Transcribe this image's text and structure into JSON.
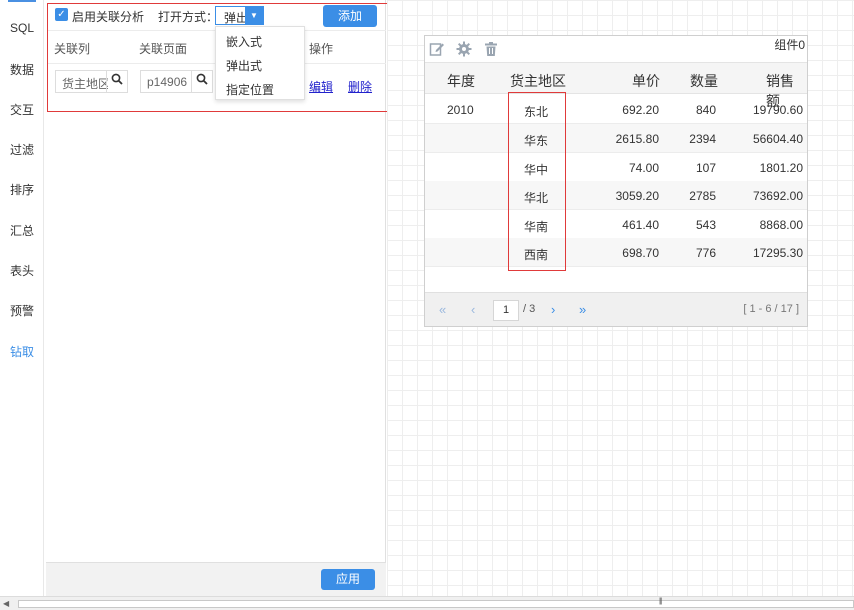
{
  "left_nav": {
    "items": [
      {
        "label": "SQL"
      },
      {
        "label": "数据"
      },
      {
        "label": "交互"
      },
      {
        "label": "过滤"
      },
      {
        "label": "排序"
      },
      {
        "label": "汇总"
      },
      {
        "label": "表头"
      },
      {
        "label": "预警"
      },
      {
        "label": "钻取"
      }
    ],
    "active_label": "钻取"
  },
  "link_panel": {
    "enable_label": "启用关联分析",
    "enabled": true,
    "open_mode_label": "打开方式：",
    "open_mode_value": "弹出",
    "open_mode_options": [
      "嵌入式",
      "弹出式",
      "指定位置"
    ],
    "add_button": "添加",
    "columns": {
      "link_col": "关联列",
      "link_page": "关联页面",
      "action": "操作"
    },
    "row": {
      "col_value": "货主地区",
      "page_value": "p14906",
      "edit": "编辑",
      "delete": "删除"
    },
    "apply_button": "应用"
  },
  "widget": {
    "title": "组件0",
    "icons": [
      "edit-icon",
      "gear-icon",
      "trash-icon"
    ],
    "headers": [
      "年度",
      "货主地区",
      "单价",
      "数量",
      "销售额"
    ],
    "rows": [
      [
        "2010",
        "东北",
        "692.20",
        "840",
        "19790.60"
      ],
      [
        "",
        "华东",
        "2615.80",
        "2394",
        "56604.40"
      ],
      [
        "",
        "华中",
        "74.00",
        "107",
        "1801.20"
      ],
      [
        "",
        "华北",
        "3059.20",
        "2785",
        "73692.00"
      ],
      [
        "",
        "华南",
        "461.40",
        "543",
        "8868.00"
      ],
      [
        "",
        "西南",
        "698.70",
        "776",
        "17295.30"
      ]
    ],
    "pager": {
      "current_page": "1",
      "total_pages": "/ 3",
      "info": "[ 1 - 6 / 17 ]",
      "first": "«",
      "prev": "‹",
      "next": "›",
      "last": "»"
    }
  },
  "colors": {
    "accent": "#3b8ee6",
    "highlight": "#e03a3a",
    "link": "#2222cc"
  }
}
